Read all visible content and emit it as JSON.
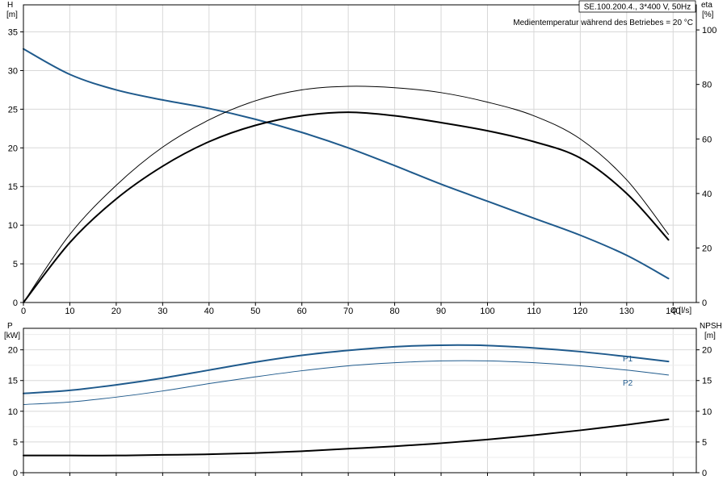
{
  "chart_data": [
    {
      "type": "line",
      "title": "SE.100.200.4., 3*400 V, 50Hz",
      "annotation": "Medientemperatur während des Betriebes = 20 °C",
      "xlabel": "Q [l/s]",
      "ylabel": "H",
      "ylabel_unit": "[m]",
      "y2label": "eta",
      "y2label_unit": "[%]",
      "xlim": [
        0,
        145
      ],
      "ylim": [
        0,
        38.5
      ],
      "y2lim": [
        0,
        109.2
      ],
      "xticks": [
        "0",
        "10",
        "20",
        "30",
        "40",
        "50",
        "60",
        "70",
        "80",
        "90",
        "100",
        "110",
        "120",
        "130",
        "140"
      ],
      "yticks": [
        "0",
        "5",
        "10",
        "15",
        "20",
        "25",
        "30",
        "35"
      ],
      "y2ticks": [
        "0",
        "20",
        "40",
        "60",
        "80",
        "100"
      ],
      "grid": true,
      "colors": {
        "head": "#1f5a8c",
        "eta": "#000000",
        "grid": "#d8d8d8",
        "frame": "#000000"
      },
      "series": [
        {
          "key": "head",
          "axis": "left",
          "color": "#1f5a8c",
          "width": 2,
          "x": [
            0,
            10,
            20,
            30,
            40,
            50,
            60,
            70,
            80,
            90,
            100,
            110,
            120,
            130,
            139
          ],
          "y": [
            32.8,
            29.5,
            27.5,
            26.2,
            25.1,
            23.7,
            22.0,
            20.0,
            17.7,
            15.3,
            13.1,
            10.9,
            8.7,
            6.1,
            3.1
          ]
        },
        {
          "key": "eta_thin",
          "axis": "right",
          "color": "#000000",
          "width": 1,
          "x": [
            0,
            10,
            20,
            30,
            40,
            50,
            60,
            70,
            80,
            90,
            100,
            110,
            120,
            130,
            139
          ],
          "y": [
            0,
            25,
            43,
            57,
            67,
            74,
            78,
            79.3,
            78.8,
            77,
            73.5,
            68.5,
            60,
            45,
            25
          ]
        },
        {
          "key": "eta_thick",
          "axis": "right",
          "color": "#000000",
          "width": 2,
          "x": [
            0,
            10,
            20,
            30,
            40,
            50,
            60,
            70,
            80,
            90,
            100,
            110,
            120,
            130,
            139
          ],
          "y": [
            0,
            22,
            38,
            50,
            59,
            65,
            68.5,
            69.8,
            68.5,
            66,
            63,
            59,
            53,
            40,
            23
          ]
        }
      ]
    },
    {
      "type": "line",
      "xlabel": "",
      "ylabel": "P",
      "ylabel_unit": "[kW]",
      "y2label": "NPSH",
      "y2label_unit": "[m]",
      "xlim": [
        0,
        145
      ],
      "ylim": [
        0,
        23.5
      ],
      "y2lim": [
        0,
        23.5
      ],
      "yticks": [
        "0",
        "5",
        "10",
        "15",
        "20"
      ],
      "y2ticks": [
        "0",
        "5",
        "10",
        "15",
        "20"
      ],
      "grid": true,
      "colors": {
        "p1": "#1f5a8c",
        "p2": "#1f5a8c",
        "npsh": "#000000"
      },
      "series": [
        {
          "key": "p1",
          "name": "P1",
          "axis": "left",
          "color": "#1f5a8c",
          "width": 2,
          "x": [
            0,
            10,
            20,
            30,
            40,
            50,
            60,
            70,
            80,
            90,
            100,
            110,
            120,
            130,
            139
          ],
          "y": [
            12.9,
            13.4,
            14.3,
            15.4,
            16.7,
            18.0,
            19.1,
            19.9,
            20.5,
            20.75,
            20.7,
            20.3,
            19.7,
            18.9,
            18.1
          ]
        },
        {
          "key": "p2",
          "name": "P2",
          "axis": "left",
          "color": "#1f5a8c",
          "width": 1,
          "x": [
            0,
            10,
            20,
            30,
            40,
            50,
            60,
            70,
            80,
            90,
            100,
            110,
            120,
            130,
            139
          ],
          "y": [
            11.1,
            11.5,
            12.3,
            13.3,
            14.5,
            15.6,
            16.6,
            17.4,
            17.9,
            18.2,
            18.2,
            17.9,
            17.4,
            16.7,
            15.9
          ]
        },
        {
          "key": "npsh",
          "axis": "right",
          "color": "#000000",
          "width": 2,
          "x": [
            0,
            10,
            20,
            30,
            40,
            50,
            60,
            70,
            80,
            90,
            100,
            110,
            120,
            130,
            139
          ],
          "y": [
            2.8,
            2.8,
            2.8,
            2.9,
            3.0,
            3.2,
            3.5,
            3.9,
            4.3,
            4.8,
            5.4,
            6.1,
            6.9,
            7.8,
            8.7
          ]
        }
      ]
    }
  ]
}
